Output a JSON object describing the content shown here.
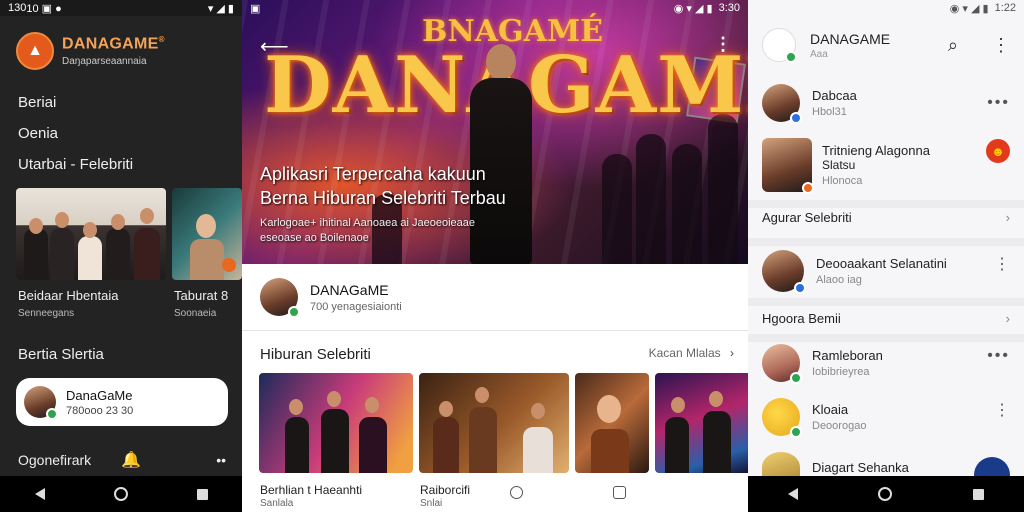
{
  "screen1": {
    "status": {
      "time": "130",
      "icons": "10 ▣ ●",
      "right": "▾ ◢ ▮"
    },
    "brand": {
      "title": "DANAGAME",
      "subtitle": "Daŋaparseaannaia",
      "sup": "®"
    },
    "menu": [
      "Beriai",
      "Oenia",
      "Utarbai - Felebriti"
    ],
    "cards": [
      {
        "label": "Beidaar Hbentaia",
        "sub": "Senneegans"
      },
      {
        "label": "Taburat 8",
        "sub": "Soonaeia"
      }
    ],
    "section": "Bertia Slertia",
    "profile": {
      "name": "DanaGaMe",
      "sub": "780ooo 23 30"
    },
    "bottom": {
      "label": "Ogonefirark",
      "icon": "bell-icon",
      "more": "••"
    }
  },
  "screen2": {
    "status": {
      "left": "▣",
      "time": "3:30",
      "icons": "◉ ▾ ◢ ▮"
    },
    "hero": {
      "title": "DANAGAME",
      "title_top": "BNAGAMÉ",
      "caption_line1": "Aplikasri Terpercaha kakuun",
      "caption_line2": "Berna Hiburan Selebriti Terbau",
      "small_line1": "Karlogoae+ ihitinal Aanoaea ai Jaeoeoieaae",
      "small_line2": "eseoase ao Boilenaoe"
    },
    "channel": {
      "name": "DANAGaME",
      "sub": "700 yenagesiaionti"
    },
    "section": {
      "title": "Hiburan Selebriti",
      "more": "Kacan Mlalas"
    },
    "thumbs": [
      {
        "label": "Berhlian t Haeanhti",
        "sub": "Sanlala"
      },
      {
        "label": "Raiborcifi",
        "sub": "Snlai"
      }
    ]
  },
  "screen3": {
    "status": {
      "icons": "◉ ▾ ◢ ▮",
      "time": "1:22"
    },
    "header": {
      "title": "DANAGAME",
      "sub": "Aaa",
      "search_icon": "search-icon",
      "more_icon": "more-vertical-icon"
    },
    "rows": [
      {
        "name": "Dabcaa",
        "sub": "Hbol31",
        "right": "•••"
      },
      {
        "name_line1": "Tritnieng Alagonna",
        "name_line2": "Slatsu",
        "sub": "Hlonoca",
        "right": "emoji-badge"
      }
    ],
    "link1": "Agurar Selebriti",
    "row3": {
      "name": "Deooaakant Selanatini",
      "sub": "Alaoo iag",
      "right": "⋮"
    },
    "link2": "Hgoora Bemii",
    "rows2": [
      {
        "name": "Ramleboran",
        "sub": "Iobibrieyrea",
        "right": "•••"
      },
      {
        "name": "Kloaia",
        "sub": "Deoorogao",
        "right": "⋮"
      },
      {
        "name": "Diagart Sehanka",
        "sub": ""
      }
    ]
  },
  "colors": {
    "accent_orange": "#e45a1c",
    "brand_gold": "#f3a25a",
    "verify_green": "#2fa44f",
    "verify_blue": "#2c6fdd"
  }
}
